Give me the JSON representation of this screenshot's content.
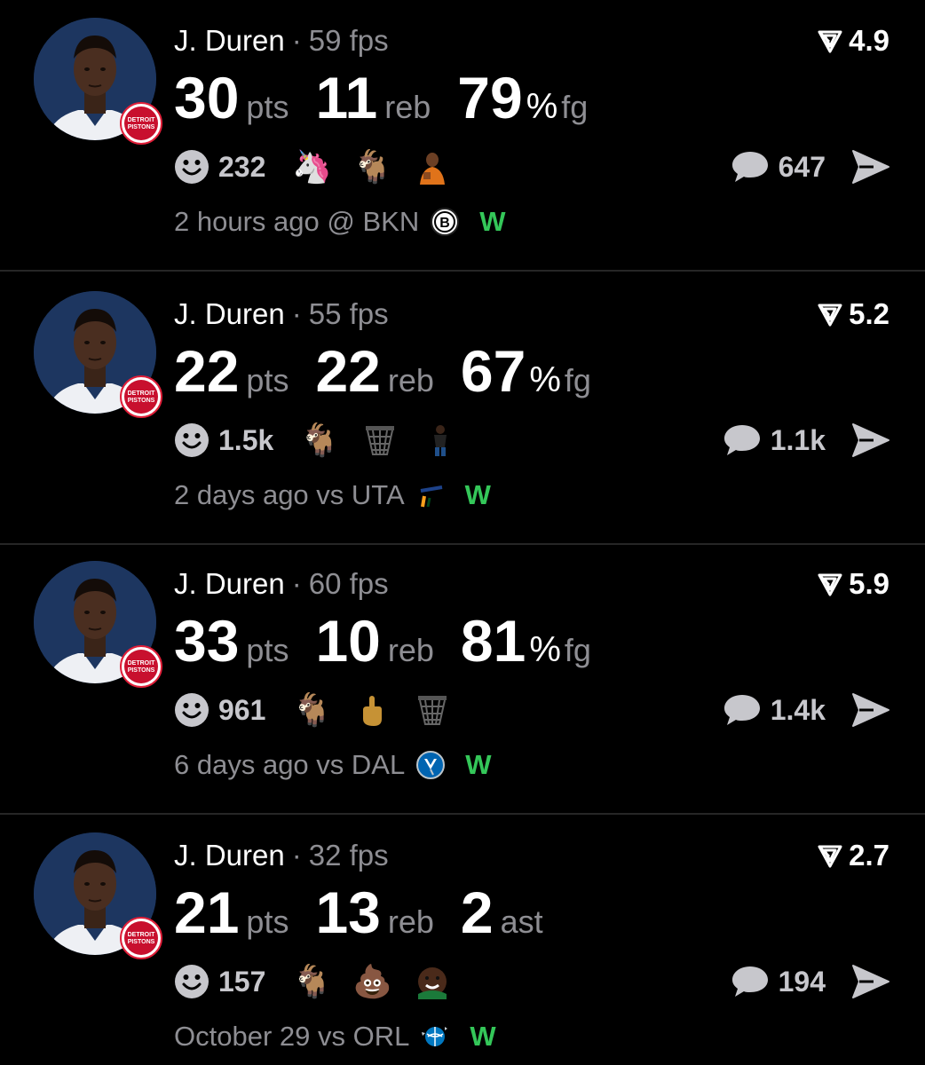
{
  "colors": {
    "background": "#000000",
    "primary_text": "#ffffff",
    "secondary_text": "#8e8e93",
    "win_color": "#34c759",
    "divider": "#262626"
  },
  "posts": [
    {
      "player": "J. Duren",
      "separator": "·",
      "fps": "59 fps",
      "rating": "4.9",
      "stats": [
        {
          "value": "30",
          "unit": "pts"
        },
        {
          "value": "11",
          "unit": "reb"
        },
        {
          "value": "79",
          "suffix": "%",
          "unit": "fg"
        }
      ],
      "reaction_count": "232",
      "reactions": [
        "unicorn-emoji",
        "goat-emoji",
        "drake-gif-emoji"
      ],
      "comment_count": "647",
      "time": "2 hours ago",
      "preposition": "@",
      "opponent": "BKN",
      "opponent_logo": "nets-logo",
      "result": "W"
    },
    {
      "player": "J. Duren",
      "separator": "·",
      "fps": "55 fps",
      "rating": "5.2",
      "stats": [
        {
          "value": "22",
          "unit": "pts"
        },
        {
          "value": "22",
          "unit": "reb"
        },
        {
          "value": "67",
          "suffix": "%",
          "unit": "fg"
        }
      ],
      "reaction_count": "1.5k",
      "reactions": [
        "goat-emoji",
        "basketball-net-emoji",
        "person-standing-emoji"
      ],
      "comment_count": "1.1k",
      "time": "2 days ago",
      "preposition": "vs",
      "opponent": "UTA",
      "opponent_logo": "jazz-logo",
      "result": "W"
    },
    {
      "player": "J. Duren",
      "separator": "·",
      "fps": "60 fps",
      "rating": "5.9",
      "stats": [
        {
          "value": "33",
          "unit": "pts"
        },
        {
          "value": "10",
          "unit": "reb"
        },
        {
          "value": "81",
          "suffix": "%",
          "unit": "fg"
        }
      ],
      "reaction_count": "961",
      "reactions": [
        "goat-emoji",
        "middle-finger-emoji",
        "basketball-net-emoji"
      ],
      "comment_count": "1.4k",
      "time": "6 days ago",
      "preposition": "vs",
      "opponent": "DAL",
      "opponent_logo": "mavericks-logo",
      "result": "W"
    },
    {
      "player": "J. Duren",
      "separator": "·",
      "fps": "32 fps",
      "rating": "2.7",
      "stats": [
        {
          "value": "21",
          "unit": "pts"
        },
        {
          "value": "13",
          "unit": "reb"
        },
        {
          "value": "2",
          "unit": "ast"
        }
      ],
      "reaction_count": "157",
      "reactions": [
        "goat-emoji",
        "poop-emoji",
        "laughing-face-gif-emoji"
      ],
      "comment_count": "194",
      "time": "October 29",
      "preposition": "vs",
      "opponent": "ORL",
      "opponent_logo": "magic-logo",
      "result": "W"
    }
  ]
}
